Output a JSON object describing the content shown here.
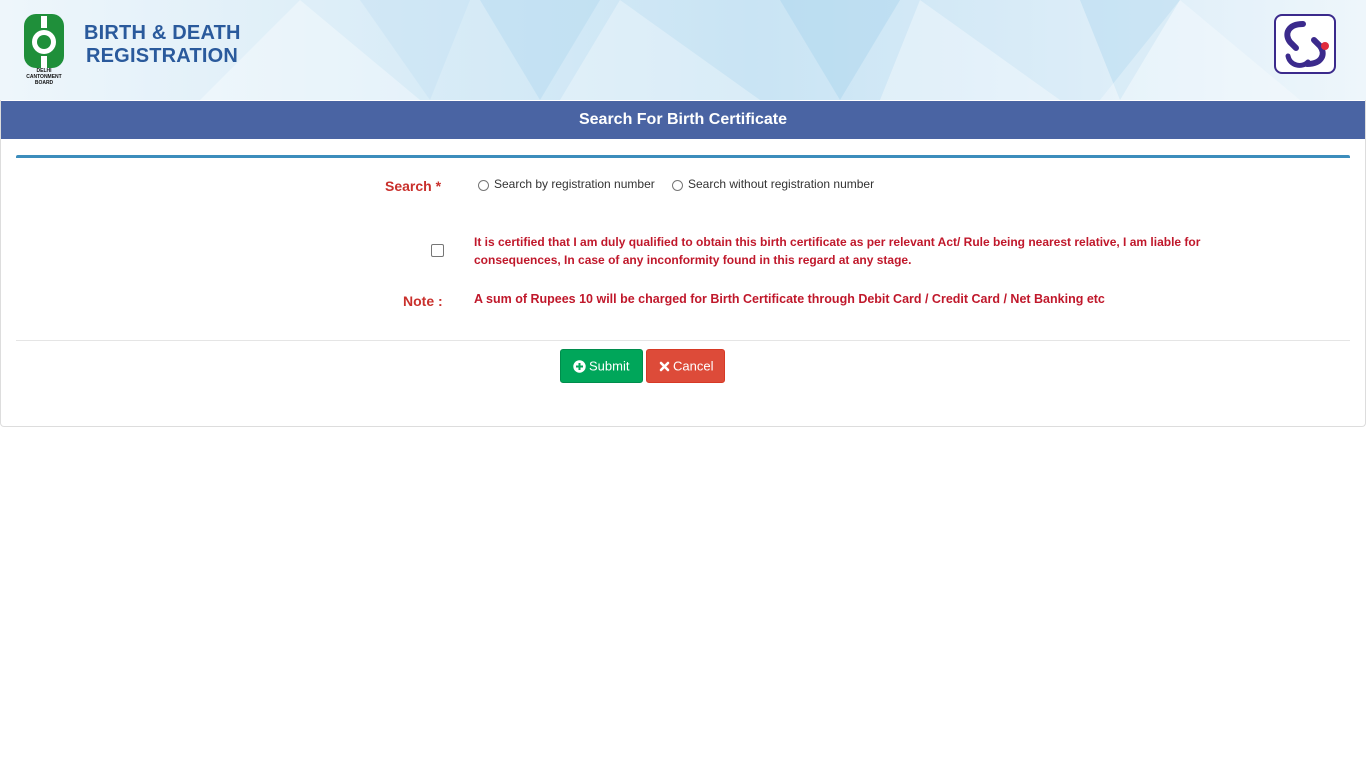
{
  "header": {
    "brand_line1": "BIRTH & DEATH",
    "brand_line2": "REGISTRATION",
    "left_logo": "delhi-cantonment-board-emblem",
    "left_logo_caption": [
      "DELHI",
      "CANTONMENT",
      "BOARD"
    ],
    "right_logo": "portal-logo"
  },
  "page": {
    "title": "Search For Birth Certificate"
  },
  "form": {
    "search_label": "Search *",
    "radio_options": [
      {
        "label": "Search by registration number",
        "selected": false
      },
      {
        "label": "Search without registration number",
        "selected": false
      }
    ],
    "certification_text": "It is certified that I am duly qualified to obtain this birth certificate as per relevant Act/ Rule being nearest relative, I am liable for consequences, In case of any inconformity found in this regard at any stage.",
    "certification_checked": false,
    "note_label": "Note :",
    "note_text": "A sum of Rupees 10 will be charged for Birth Certificate through Debit Card / Credit Card / Net Banking etc"
  },
  "actions": {
    "submit_label": "Submit",
    "submit_icon": "plus-circle-icon",
    "cancel_label": "Cancel",
    "cancel_icon": "close-icon"
  },
  "colors": {
    "title_bar": "#4a64a3",
    "brand_text": "#2a5a9c",
    "label_red": "#c9302c",
    "text_red": "#c0182b",
    "submit_green": "#00a65a",
    "cancel_red": "#dd4b39",
    "panel_accent": "#3c8dbc"
  }
}
